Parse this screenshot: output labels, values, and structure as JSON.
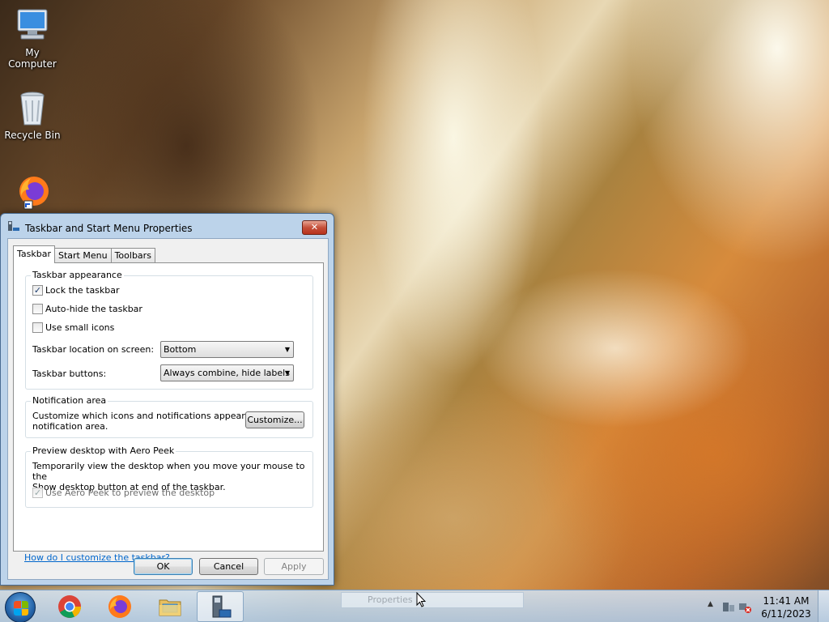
{
  "desktop": {
    "icons": [
      {
        "label": "My Computer",
        "icon": "computer-icon"
      },
      {
        "label": "Recycle Bin",
        "icon": "recycle-bin-icon"
      },
      {
        "label": "",
        "icon": "firefox-shortcut-icon"
      }
    ]
  },
  "dialog": {
    "title": "Taskbar and Start Menu Properties",
    "close_label": "✕",
    "tabs": [
      {
        "label": "Taskbar",
        "active": true
      },
      {
        "label": "Start Menu",
        "active": false
      },
      {
        "label": "Toolbars",
        "active": false
      }
    ],
    "appearance": {
      "title": "Taskbar appearance",
      "lock_label": "Lock the taskbar",
      "lock_checked": true,
      "autohide_label": "Auto-hide the taskbar",
      "autohide_checked": false,
      "small_icons_label": "Use small icons",
      "small_icons_checked": false,
      "location_label": "Taskbar location on screen:",
      "location_value": "Bottom",
      "buttons_label": "Taskbar buttons:",
      "buttons_value": "Always combine, hide labels"
    },
    "notification": {
      "title": "Notification area",
      "text_line1": "Customize which icons and notifications appear in the",
      "text_line2": "notification area.",
      "customize_label": "Customize..."
    },
    "aero_peek": {
      "title": "Preview desktop with Aero Peek",
      "text_line1": "Temporarily view the desktop when you move your mouse to the",
      "text_line2": "Show desktop button at end of the taskbar.",
      "checkbox_label": "Use Aero Peek to preview the desktop",
      "checkbox_checked": true,
      "checkbox_disabled": true
    },
    "help_link": "How do I customize the taskbar?",
    "buttons": {
      "ok": "OK",
      "cancel": "Cancel",
      "apply": "Apply"
    }
  },
  "taskbar": {
    "apps": [
      {
        "icon": "chrome-icon",
        "active": false
      },
      {
        "icon": "firefox-icon",
        "active": false
      },
      {
        "icon": "file-explorer-icon",
        "active": false
      },
      {
        "icon": "taskbar-properties-icon",
        "active": true
      }
    ],
    "hover_text": "Properties",
    "clock": {
      "time": "11:41 AM",
      "date": "6/11/2023"
    }
  },
  "colors": {
    "accent_link": "#0066cc",
    "close_button": "#c5503a",
    "dialog_frame": "#bcd3ea"
  }
}
